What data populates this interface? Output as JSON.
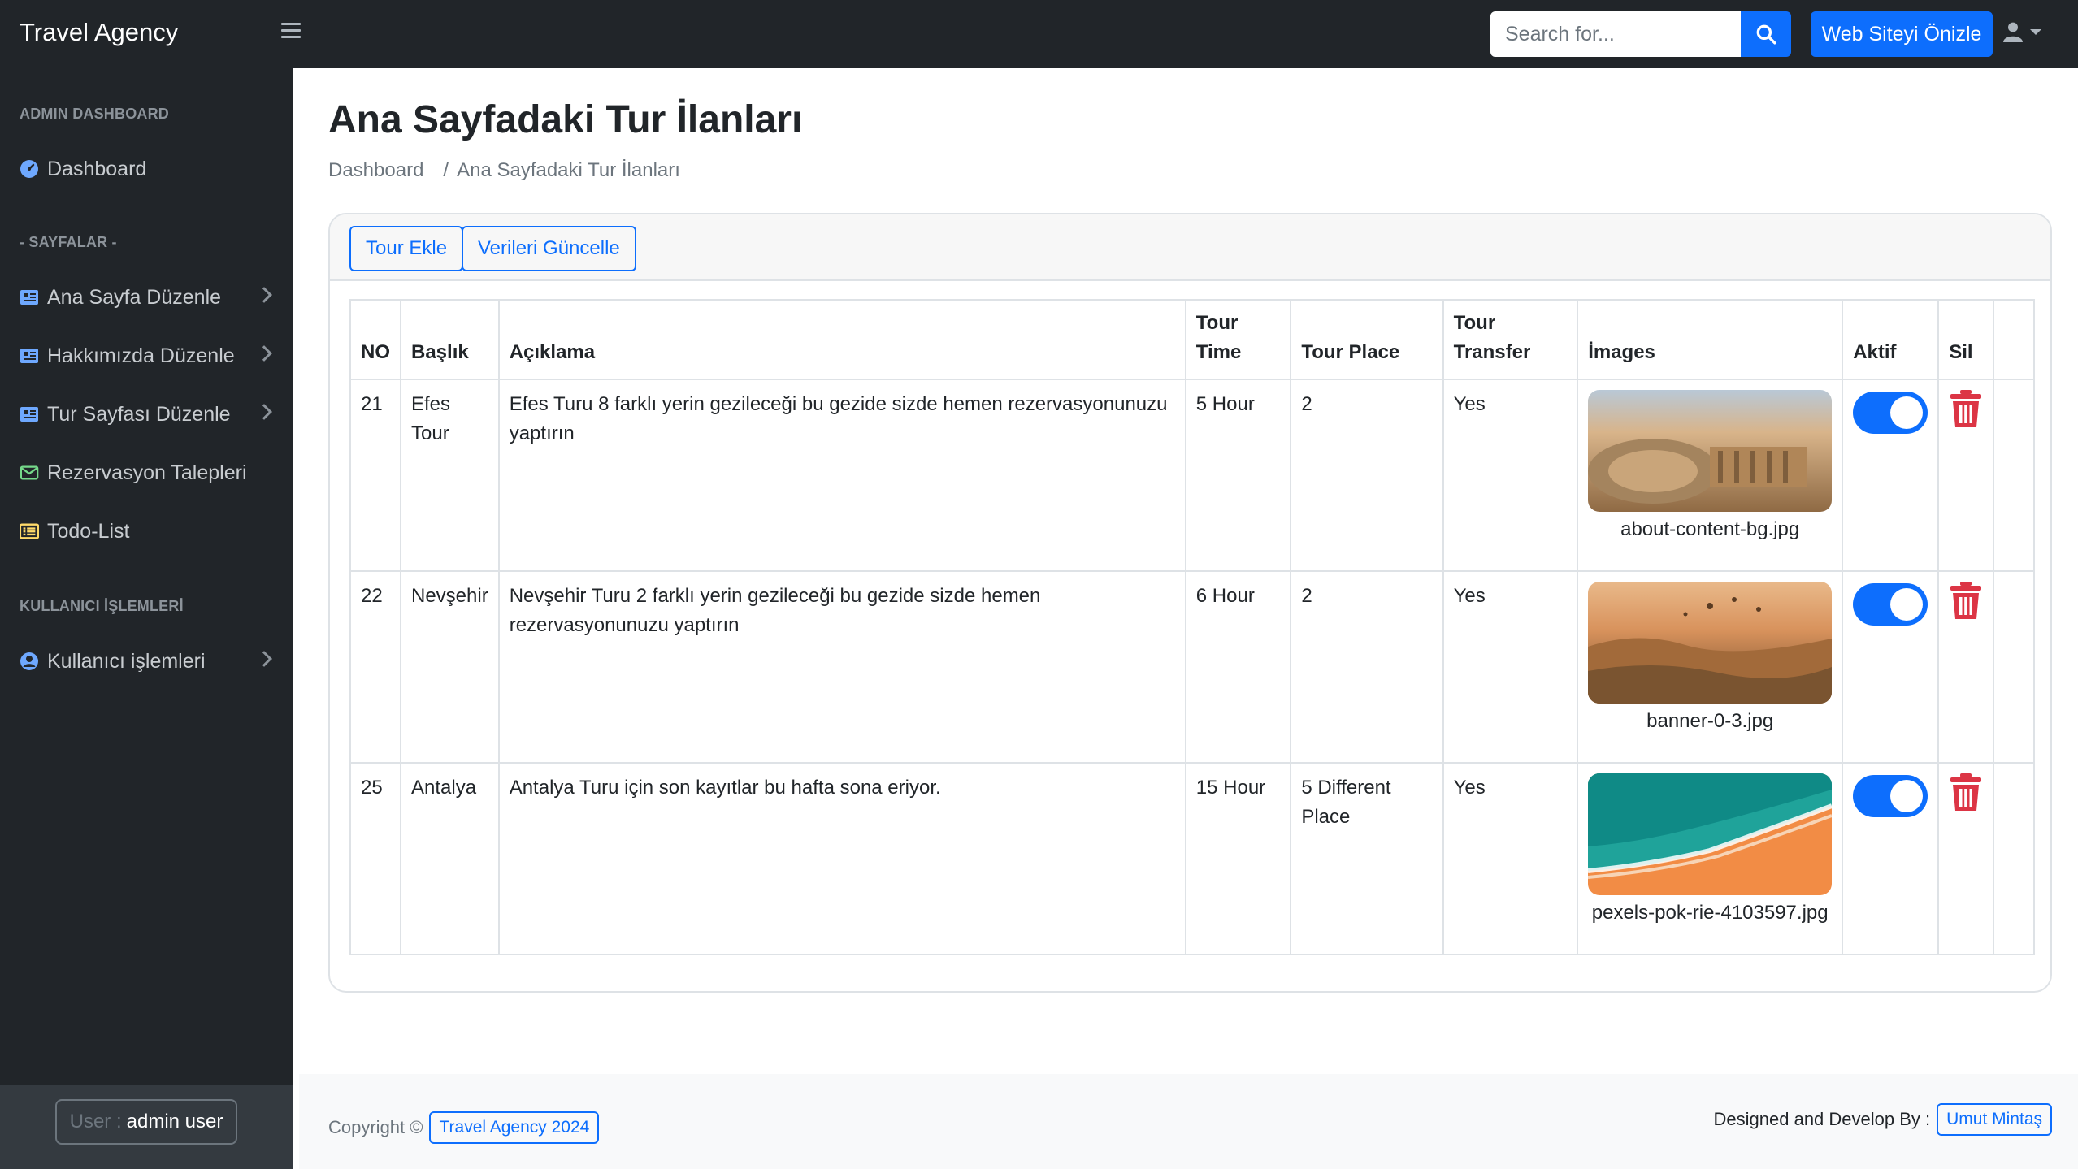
{
  "app": {
    "brand": "Travel Agency"
  },
  "topnav": {
    "search_placeholder": "Search for...",
    "preview_label": "Web Siteyi Önizle"
  },
  "sidebar": {
    "heading_admin": "ADMIN DASHBOARD",
    "dashboard": "Dashboard",
    "heading_pages": "- SAYFALAR -",
    "items": [
      {
        "label": "Ana Sayfa Düzenle",
        "icon": "newspaper-icon"
      },
      {
        "label": "Hakkımızda Düzenle",
        "icon": "newspaper-icon"
      },
      {
        "label": "Tur Sayfası Düzenle",
        "icon": "newspaper-icon"
      },
      {
        "label": "Rezervasyon Talepleri",
        "icon": "envelope-icon"
      },
      {
        "label": "Todo-List",
        "icon": "list-icon"
      }
    ],
    "heading_users": "KULLANICI İŞLEMLERİ",
    "user_ops": "Kullanıcı işlemleri",
    "user_badge_label": "User :",
    "user_badge_value": "admin user"
  },
  "main": {
    "title": "Ana Sayfadaki Tur İlanları",
    "breadcrumb": {
      "home": "Dashboard",
      "sep": "/",
      "current": "Ana Sayfadaki Tur İlanları"
    },
    "buttons": {
      "add": "Tour Ekle",
      "update": "Verileri Güncelle"
    },
    "table": {
      "headers": {
        "no": "NO",
        "title": "Başlık",
        "desc": "Açıklama",
        "time_1": "Tour",
        "time_2": "Time",
        "place": "Tour Place",
        "transfer_1": "Tour",
        "transfer_2": "Transfer",
        "images": "İmages",
        "active": "Aktif",
        "delete": "Sil"
      },
      "rows": [
        {
          "no": "21",
          "title": "Efes Tour",
          "desc": "Efes Turu 8 farklı yerin gezileceği bu gezide sizde hemen rezervasyonunuzu yaptırın",
          "time": "5 Hour",
          "place": "2",
          "transfer": "Yes",
          "image": "about-content-bg.jpg",
          "active": true
        },
        {
          "no": "22",
          "title": "Nevşehir",
          "desc": "Nevşehir Turu 2 farklı yerin gezileceği bu gezide sizde hemen rezervasyonunuzu yaptırın",
          "time": "6 Hour",
          "place": "2",
          "transfer": "Yes",
          "image": "banner-0-3.jpg",
          "active": true
        },
        {
          "no": "25",
          "title": "Antalya",
          "desc": "Antalya Turu için son kayıtlar bu hafta sona eriyor.",
          "time": "15 Hour",
          "place": "5 Different Place",
          "transfer": "Yes",
          "image": "pexels-pok-rie-4103597.jpg",
          "active": true
        }
      ]
    }
  },
  "footer": {
    "copyright": "Copyright ©",
    "copyright_link": "Travel Agency 2024",
    "designed": "Designed and Develop By :",
    "designer": "Umut Mintaş"
  },
  "colors": {
    "primary": "#0d6efd",
    "danger": "#dc3545",
    "dark": "#212529"
  }
}
